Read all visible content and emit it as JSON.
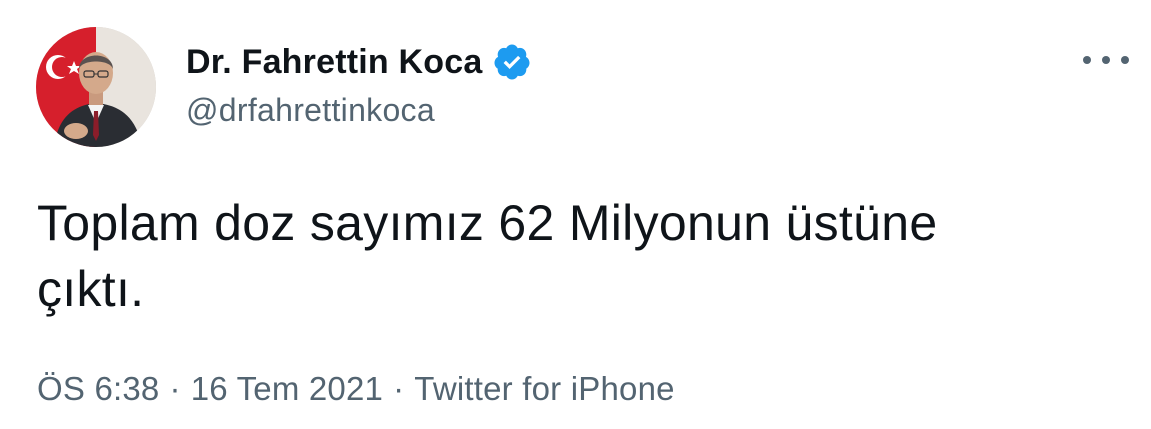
{
  "author": {
    "display_name": "Dr. Fahrettin Koca",
    "handle": "@drfahrettinkoca",
    "verified": true
  },
  "tweet": {
    "text": "Toplam doz sayımız 62 Milyonun üstüne\nçıktı."
  },
  "meta": {
    "time": "ÖS 6:38",
    "date": "16 Tem 2021",
    "separator": "·",
    "source": "Twitter for iPhone"
  },
  "icons": {
    "verified": "verified-badge-icon",
    "more": "more-horizontal-icon"
  },
  "colors": {
    "text": "#0f1419",
    "secondary": "#536471",
    "verified_blue": "#1d9bf0"
  }
}
